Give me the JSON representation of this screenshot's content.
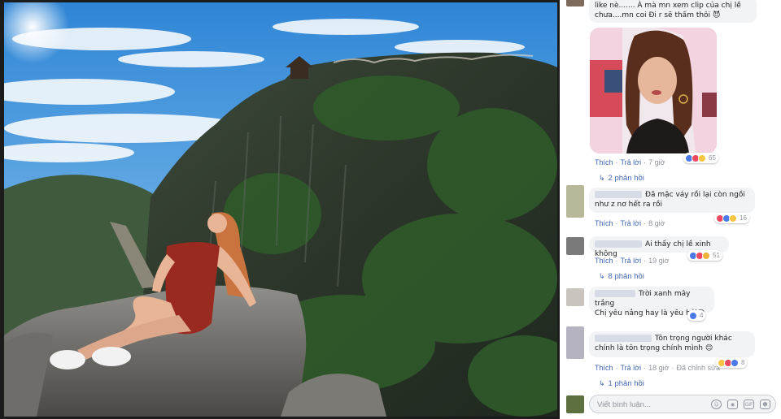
{
  "top_comment": {
    "text_line1": "like nè....... À mà mn xem clip của chị lề",
    "text_line2": "chưa....mn coi Đi r sẽ thấm thôi",
    "emoji": "😈"
  },
  "video_comment": {
    "actions": {
      "like": "Thích",
      "reply": "Trả lời",
      "time": "7 giờ"
    },
    "reactions": [
      "like",
      "love",
      "haha"
    ],
    "reaction_count": "65",
    "replies": "2 phản hồi"
  },
  "comments": [
    {
      "line1": "Đã mặc váy rồi lại còn ngồi",
      "line2": "như z nơ hết ra rồi",
      "avatar_color": "#b7b89a",
      "actions": {
        "like": "Thích",
        "reply": "Trả lời",
        "time": "8 giờ"
      },
      "reactions": [
        "love",
        "like",
        "haha"
      ],
      "reaction_count": "16"
    },
    {
      "line1": "Ai thấy chị lề xinh không",
      "avatar_color": "#7a7a7a",
      "actions": {
        "like": "Thích",
        "reply": "Trả lời",
        "time": "19 giờ"
      },
      "reactions": [
        "like",
        "love",
        "wow"
      ],
      "reaction_count": "51",
      "replies": "8 phản hồi"
    },
    {
      "line1": "Trời xanh mây trắng",
      "line2": "Chị yêu nắng hay là yêu hải",
      "emoji": "😊",
      "avatar_color": "#c9c4bd",
      "reactions": [
        "like"
      ],
      "reaction_count": "4"
    },
    {
      "line1": "Tôn trọng người khác",
      "line2": "chính là tôn trọng chính mình",
      "emoji": "😊",
      "avatar_color": "#b5b3c2",
      "actions": {
        "like": "Thích",
        "reply": "Trả lời",
        "time": "18 giờ",
        "edited": "Đã chỉnh sửa"
      },
      "reactions": [
        "haha",
        "love",
        "like"
      ],
      "reaction_count": "8",
      "replies": "1 phản hồi"
    }
  ],
  "composer": {
    "placeholder": "Viết bình luận...",
    "icons": [
      "emoji-icon",
      "camera-icon",
      "gif-icon",
      "sticker-icon"
    ]
  },
  "colors": {
    "link": "#4267b2",
    "meta": "#90949c",
    "bubble": "#f2f3f5"
  }
}
